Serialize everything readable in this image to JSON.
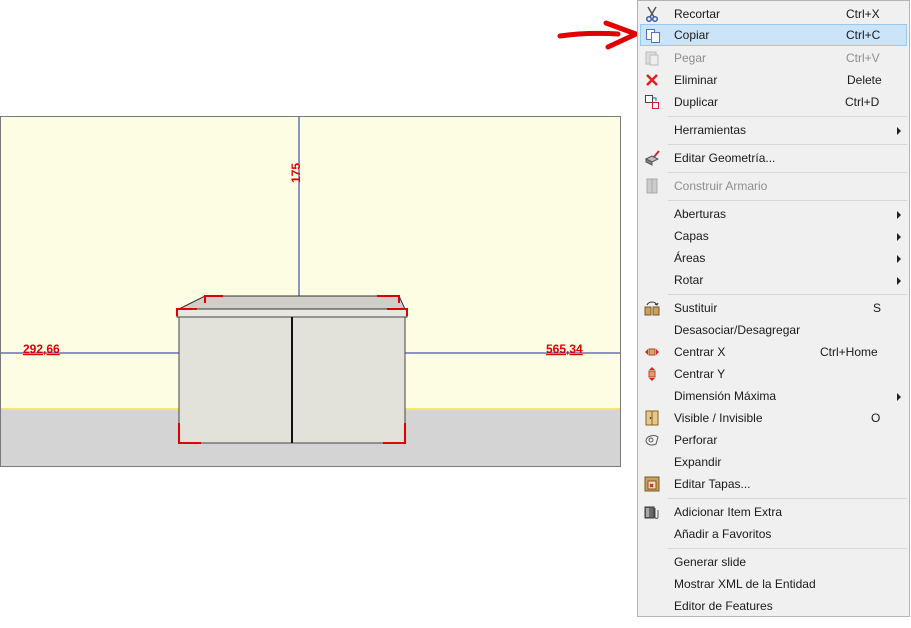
{
  "viewport": {
    "dim_left": "292,66",
    "dim_right": "565,34",
    "dim_top": "175",
    "colors": {
      "wall": "#fdfde3",
      "floor": "#d4d4d4",
      "dimension_line": "#1b2aa8",
      "dimension_text": "#e00000",
      "cabinet": "#e4e4dc"
    }
  },
  "menu": {
    "items": [
      {
        "label": "Recortar",
        "shortcut": "Ctrl+X",
        "icon": "scissors-icon"
      },
      {
        "label": "Copiar",
        "shortcut": "Ctrl+C",
        "icon": "copy-icon",
        "highlighted": true
      },
      {
        "label": "Pegar",
        "shortcut": "Ctrl+V",
        "icon": "paste-icon",
        "disabled": true
      },
      {
        "label": "Eliminar",
        "shortcut": "Delete",
        "icon": "delete-x-icon"
      },
      {
        "label": "Duplicar",
        "shortcut": "Ctrl+D",
        "icon": "duplicate-icon"
      },
      {
        "label": "Herramientas",
        "submenu": true
      },
      {
        "label": "Editar Geometría...",
        "icon": "edit-geometry-icon"
      },
      {
        "label": "Construir Armario",
        "icon": "build-wardrobe-icon",
        "disabled": true
      },
      {
        "label": "Aberturas",
        "submenu": true
      },
      {
        "label": "Capas",
        "submenu": true
      },
      {
        "label": "Áreas",
        "submenu": true
      },
      {
        "label": "Rotar",
        "submenu": true
      },
      {
        "label": "Sustituir",
        "shortcut": "S",
        "icon": "substitute-icon"
      },
      {
        "label": "Desasociar/Desagregar"
      },
      {
        "label": "Centrar X",
        "shortcut": "Ctrl+Home",
        "icon": "center-x-icon"
      },
      {
        "label": "Centrar Y",
        "icon": "center-y-icon"
      },
      {
        "label": "Dimensión Máxima",
        "submenu": true
      },
      {
        "label": "Visible / Invisible",
        "shortcut": "O",
        "icon": "visibility-door-icon"
      },
      {
        "label": "Perforar",
        "icon": "drill-icon"
      },
      {
        "label": "Expandir"
      },
      {
        "label": "Editar Tapas...",
        "icon": "edit-covers-icon"
      },
      {
        "label": "Adicionar Item Extra",
        "icon": "add-extra-item-icon"
      },
      {
        "label": "Añadir a Favoritos"
      },
      {
        "label": "Generar slide"
      },
      {
        "label": "Mostrar XML de la Entidad"
      },
      {
        "label": "Editor de Features"
      }
    ]
  }
}
